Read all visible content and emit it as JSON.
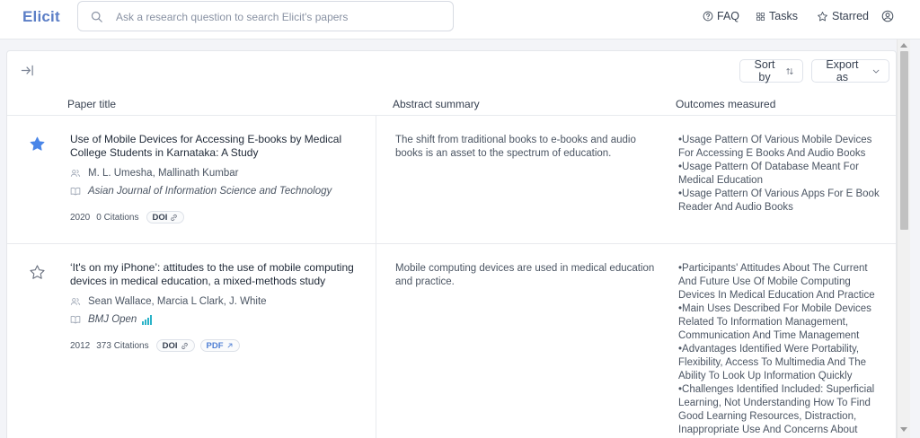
{
  "app": {
    "logo": "Elicit"
  },
  "search": {
    "placeholder": "Ask a research question to search Elicit's papers",
    "value": ""
  },
  "nav": {
    "faq": "FAQ",
    "tasks": "Tasks",
    "starred": "Starred"
  },
  "toolbar": {
    "sort_label": "Sort by",
    "export_label": "Export as"
  },
  "columns": {
    "title": "Paper title",
    "abstract": "Abstract summary",
    "outcomes": "Outcomes measured"
  },
  "papers": [
    {
      "starred": true,
      "title": "Use of Mobile Devices for Accessing E-books by Medical College Students in Karnataka: A Study",
      "authors": "M. L. Umesha, Mallinath Kumbar",
      "journal": "Asian Journal of Information Science and Technology",
      "year": "2020",
      "citations": "0 Citations",
      "doi_label": "DOI",
      "abstract": "The shift from traditional books to e-books and audio books is an asset to the spectrum of education.",
      "outcomes": [
        "•Usage Pattern Of Various Mobile Devices For Accessing E Books And Audio Books",
        "•Usage Pattern Of Database Meant For Medical Education",
        "•Usage Pattern Of Various Apps For E Book Reader And Audio Books"
      ]
    },
    {
      "starred": false,
      "title": "‘It's on my iPhone’: attitudes to the use of mobile computing devices in medical education, a mixed-methods study",
      "authors": "Sean Wallace, Marcia L Clark, J. White",
      "journal": "BMJ Open",
      "year": "2012",
      "citations": "373 Citations",
      "doi_label": "DOI",
      "pdf_label": "PDF",
      "abstract": "Mobile computing devices are used in medical education and practice.",
      "outcomes": [
        "•Participants' Attitudes About The Current And Future Use Of Mobile Computing Devices In Medical Education And Practice",
        "•Main Uses Described For Mobile Devices Related To Information Management, Communication And Time Management",
        "•Advantages Identified Were Portability, Flexibility, Access To Multimedia And The Ability To Look Up Information Quickly",
        "•Challenges Identified Included: Superficial Learning, Not Understanding How To Find Good Learning Resources, Distraction, Inappropriate Use And Concerns About"
      ]
    }
  ],
  "colors": {
    "brand": "#5b7ec6",
    "star_filled": "#4a86e8",
    "quality_bars": "#2bb3c8",
    "pdf_link": "#4f7fd4"
  },
  "icons": {
    "search": "search-icon",
    "faq": "question-circle-icon",
    "tasks": "grid-icon",
    "starred": "star-outline-icon",
    "account": "user-circle-icon",
    "collapse": "arrow-right-to-line-icon",
    "sort": "sort-arrows-icon",
    "export": "chevron-down-icon",
    "authors": "users-icon",
    "journal": "book-open-icon",
    "doi": "link-icon",
    "pdf": "arrow-up-right-icon",
    "quality": "signal-bars-icon"
  }
}
